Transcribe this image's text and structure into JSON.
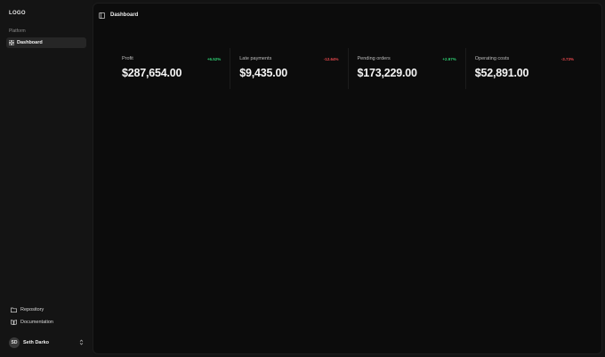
{
  "sidebar": {
    "logo": "LOGO",
    "group_label": "Platform",
    "nav_items": [
      {
        "label": "Dashboard",
        "icon": "grid-icon",
        "active": true
      }
    ],
    "bottom_links": [
      {
        "label": "Repository",
        "icon": "folder-icon"
      },
      {
        "label": "Documentation",
        "icon": "book-icon"
      }
    ],
    "user": {
      "initials": "SD",
      "name": "Seth Darko"
    }
  },
  "header": {
    "title": "Dashboard",
    "toggle_icon": "sidebar-toggle-icon"
  },
  "stats": [
    {
      "label": "Profit",
      "change": "+6.52%",
      "trend": "up",
      "value": "$287,654.00"
    },
    {
      "label": "Late payments",
      "change": "-12.64%",
      "trend": "down",
      "value": "$9,435.00"
    },
    {
      "label": "Pending orders",
      "change": "+2.97%",
      "trend": "up",
      "value": "$173,229.00"
    },
    {
      "label": "Operating costs",
      "change": "-3.73%",
      "trend": "down",
      "value": "$52,891.00"
    }
  ],
  "colors": {
    "positive": "#2ecc71",
    "negative": "#e5484d",
    "sidebar_bg": "#141414",
    "panel_bg": "#0c0c0c"
  }
}
